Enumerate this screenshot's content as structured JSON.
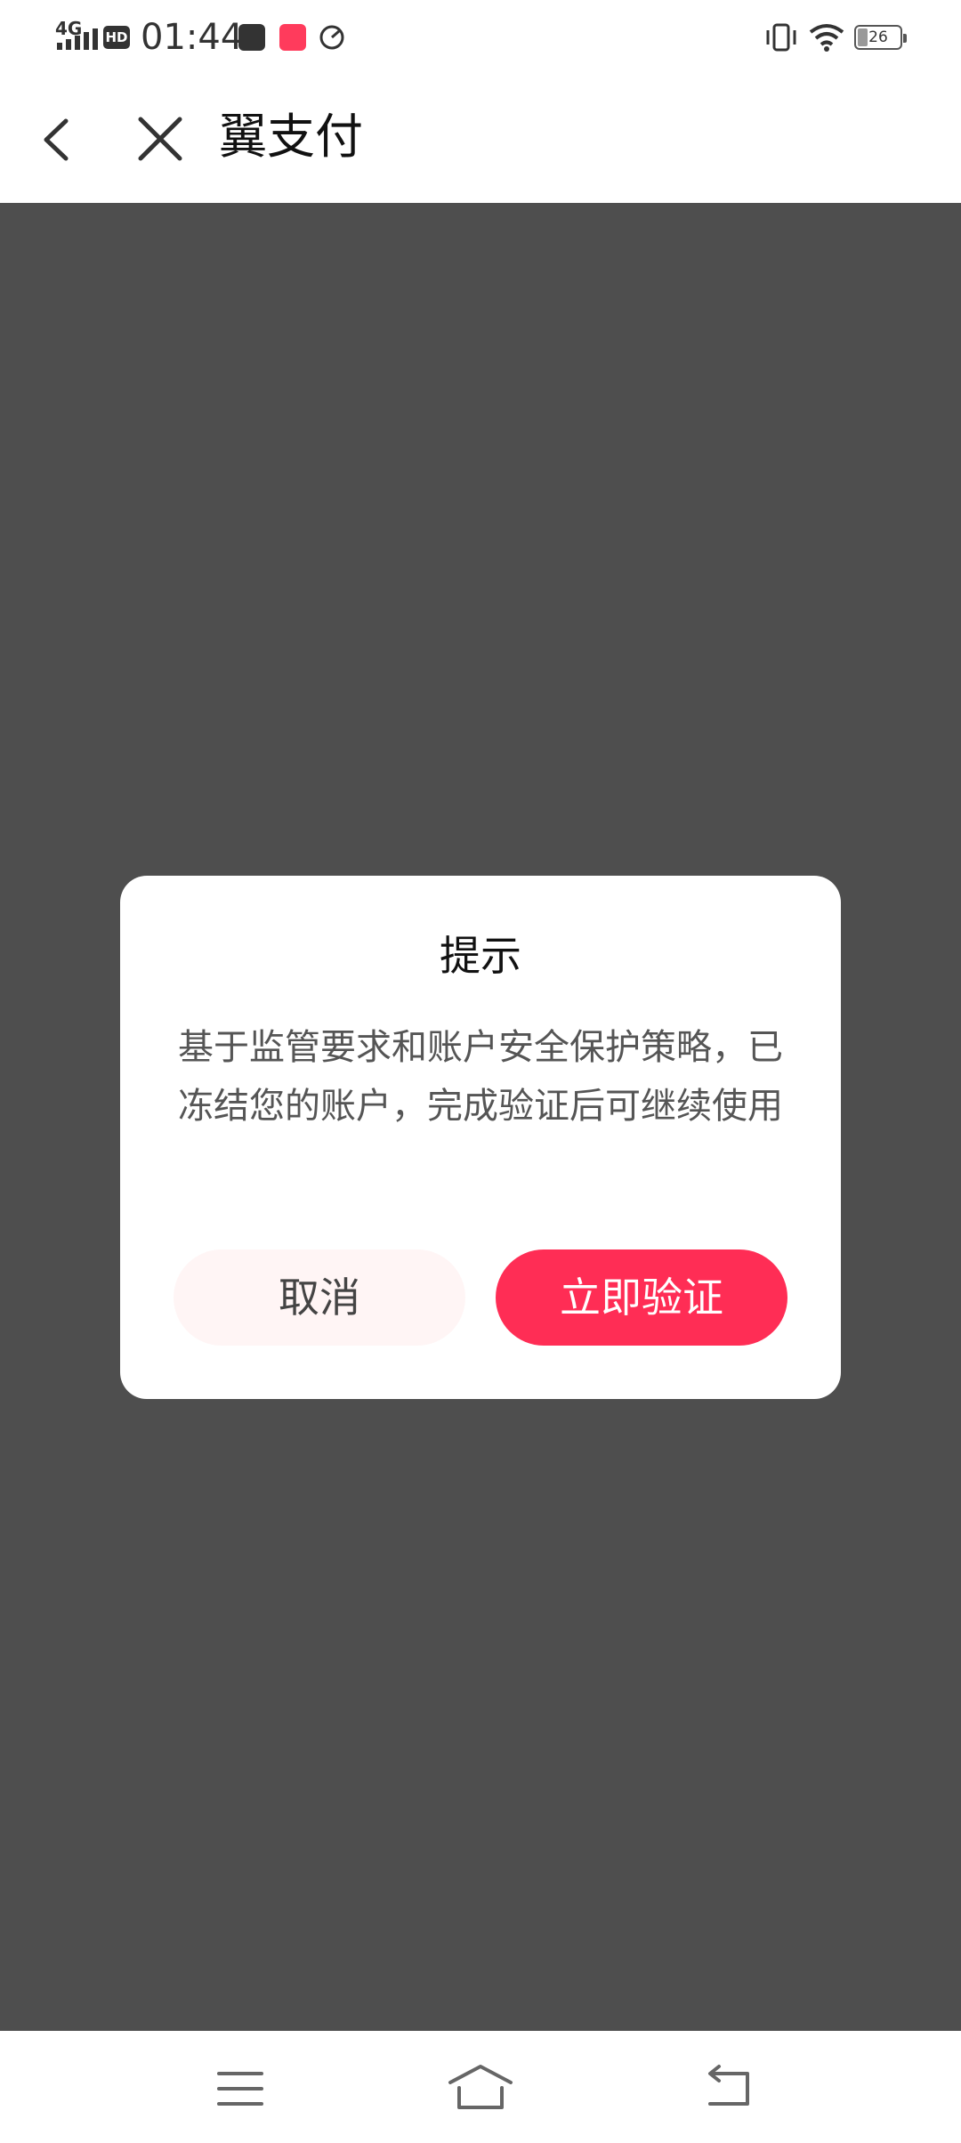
{
  "status_bar": {
    "network": "4G",
    "hd_badge": "HD",
    "time": "01:44",
    "battery_level": "26"
  },
  "nav": {
    "title": "翼支付"
  },
  "dialog": {
    "title": "提示",
    "message": "基于监管要求和账户安全保护策略，已冻结您的账户，完成验证后可继续使用",
    "cancel_label": "取消",
    "confirm_label": "立即验证"
  },
  "colors": {
    "accent": "#ff2d55",
    "overlay": "#4e4e4e",
    "cancel_bg": "#fff5f5"
  },
  "icons": {
    "back": "chevron-left-icon",
    "close": "close-icon",
    "system_menu": "menu-icon",
    "system_home": "home-icon",
    "system_back": "return-icon"
  }
}
